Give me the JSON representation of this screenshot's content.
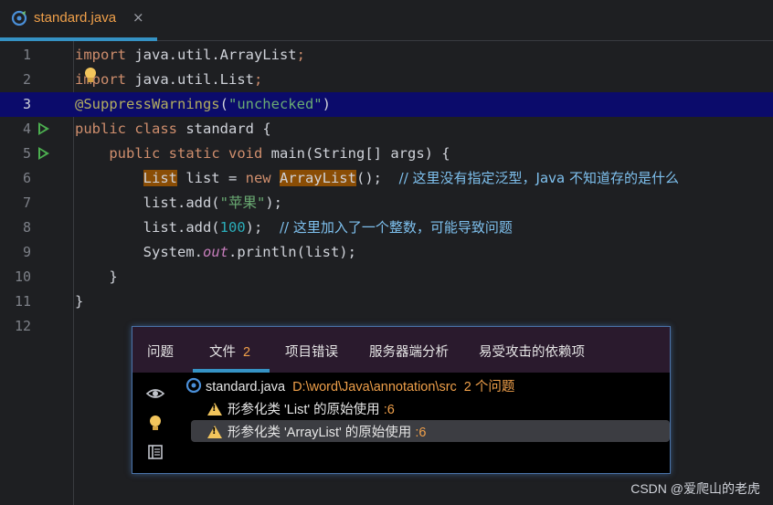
{
  "tab": {
    "filename": "standard.java",
    "close": "×"
  },
  "code": {
    "l1": {
      "kw": "import",
      "rest": " java.util.ArrayList",
      "semi": ";"
    },
    "l2": {
      "kw": "import",
      "rest": " java.util.List",
      "semi": ";"
    },
    "l3": {
      "ann": "@SuppressWarnings",
      "p1": "(",
      "str": "\"unchecked\"",
      "p2": ")"
    },
    "l4": {
      "kw1": "public",
      "kw2": "class",
      "name": " standard {"
    },
    "l5": {
      "indent": "    ",
      "kw1": "public",
      "kw2": "static",
      "kw3": "void",
      "sig": " main(String[] args) {"
    },
    "l6": {
      "indent": "        ",
      "type": "List",
      "mid": " list = ",
      "kw": "new",
      "sp": " ",
      "ctor": "ArrayList",
      "end": "();  ",
      "comment": "// 这里没有指定泛型，Java 不知道存的是什么"
    },
    "l7": {
      "indent": "        ",
      "pre": "list.add(",
      "str": "\"苹果\"",
      "post": ");"
    },
    "l8": {
      "indent": "        ",
      "pre": "list.add(",
      "num": "100",
      "post": ");  ",
      "comment": "// 这里加入了一个整数，可能导致问题"
    },
    "l9": {
      "indent": "        ",
      "pre": "System.",
      "field": "out",
      "post": ".println(list);"
    },
    "l10": {
      "text": "    }"
    },
    "l11": {
      "text": "}"
    }
  },
  "line_numbers": [
    "1",
    "2",
    "3",
    "4",
    "5",
    "6",
    "7",
    "8",
    "9",
    "10",
    "11",
    "12"
  ],
  "problems": {
    "tabs": [
      {
        "label": "问题"
      },
      {
        "label": "文件",
        "count": "2"
      },
      {
        "label": "项目错误"
      },
      {
        "label": "服务器端分析"
      },
      {
        "label": "易受攻击的依赖项"
      }
    ],
    "file": {
      "name": "standard.java",
      "path": "D:\\word\\Java\\annotation\\src",
      "count": "2 个问题"
    },
    "items": [
      {
        "text": "形参化类 'List' 的原始使用 ",
        "line": ":6"
      },
      {
        "text": "形参化类 'ArrayList' 的原始使用 ",
        "line": ":6"
      }
    ]
  },
  "watermark": "CSDN @爱爬山的老虎",
  "colors": {
    "accent": "#3592c4",
    "keyword": "#cf8e6d",
    "string": "#6aab73",
    "number": "#2aacb8",
    "warning": "#f0a04a",
    "highlight_line": "#0b0b6b"
  }
}
